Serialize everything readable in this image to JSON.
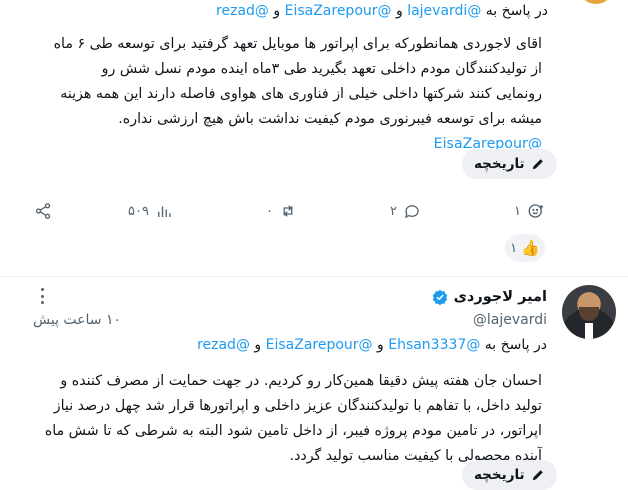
{
  "tweet1": {
    "reply_prefix": "در پاسخ به",
    "reply_handles": [
      "@lajevardi",
      "@EisaZarepour",
      "@rezad"
    ],
    "reply_joiner": "و",
    "body_lines": [
      "اقای لاجوردی همانطورکه برای اپراتور ها موبایل تعهد گرفتید برای توسعه طی ۶ ماه",
      "از تولیدکنندگان مودم داخلی تعهد بگیرید طی ۳ماه اینده مودم نسل شش رو",
      "رونمایی کنند شرکتها داخلی خیلی از فناوری های هواوی فاصله دارند این همه هزینه",
      "میشه برای توسعه فیبرنوری مودم کیفیت نداشت باش هیچ ارزشی نداره."
    ],
    "mention": "@EisaZarepour",
    "history_label": "تاریخچه",
    "actions": {
      "reply_count": "۲",
      "retweet_count": "۰",
      "like_count": "۱",
      "views_count": "۵۰۹"
    },
    "reaction": {
      "emoji": "👍",
      "count": "۱"
    }
  },
  "tweet2": {
    "author_name": "امیر لاجوردی",
    "handle": "@lajevardi",
    "time": "۱۰ ساعت پیش",
    "reply_prefix": "در پاسخ به",
    "reply_handles": [
      "@Ehsan3337",
      "@EisaZarepour",
      "@rezad"
    ],
    "reply_joiner": "و",
    "body_lines": [
      "احسان جان هفته پیش دقیقا همین‌کار رو کردیم. در جهت حمایت از مصرف کننده و",
      "تولید داخل، با تفاهم با تولیدکنندگان عزیز داخلی و اپراتورها قرار شد چهل درصد نیاز",
      "اپراتور، در تامین مودم پروژه فیبر، از داخل تامین شود البته به شرطی که تا شش ماه",
      "آینده محصولی با کیفیت مناسب تولید گردد."
    ],
    "history_label": "تاریخچه"
  },
  "colors": {
    "accent": "#1d9bf0",
    "muted": "#536471",
    "verified": "#1d9bf0"
  },
  "icons": [
    "share-icon",
    "views-icon",
    "retweet-icon",
    "reply-icon",
    "like-icon",
    "pencil-icon",
    "verified-icon",
    "more-icon"
  ]
}
